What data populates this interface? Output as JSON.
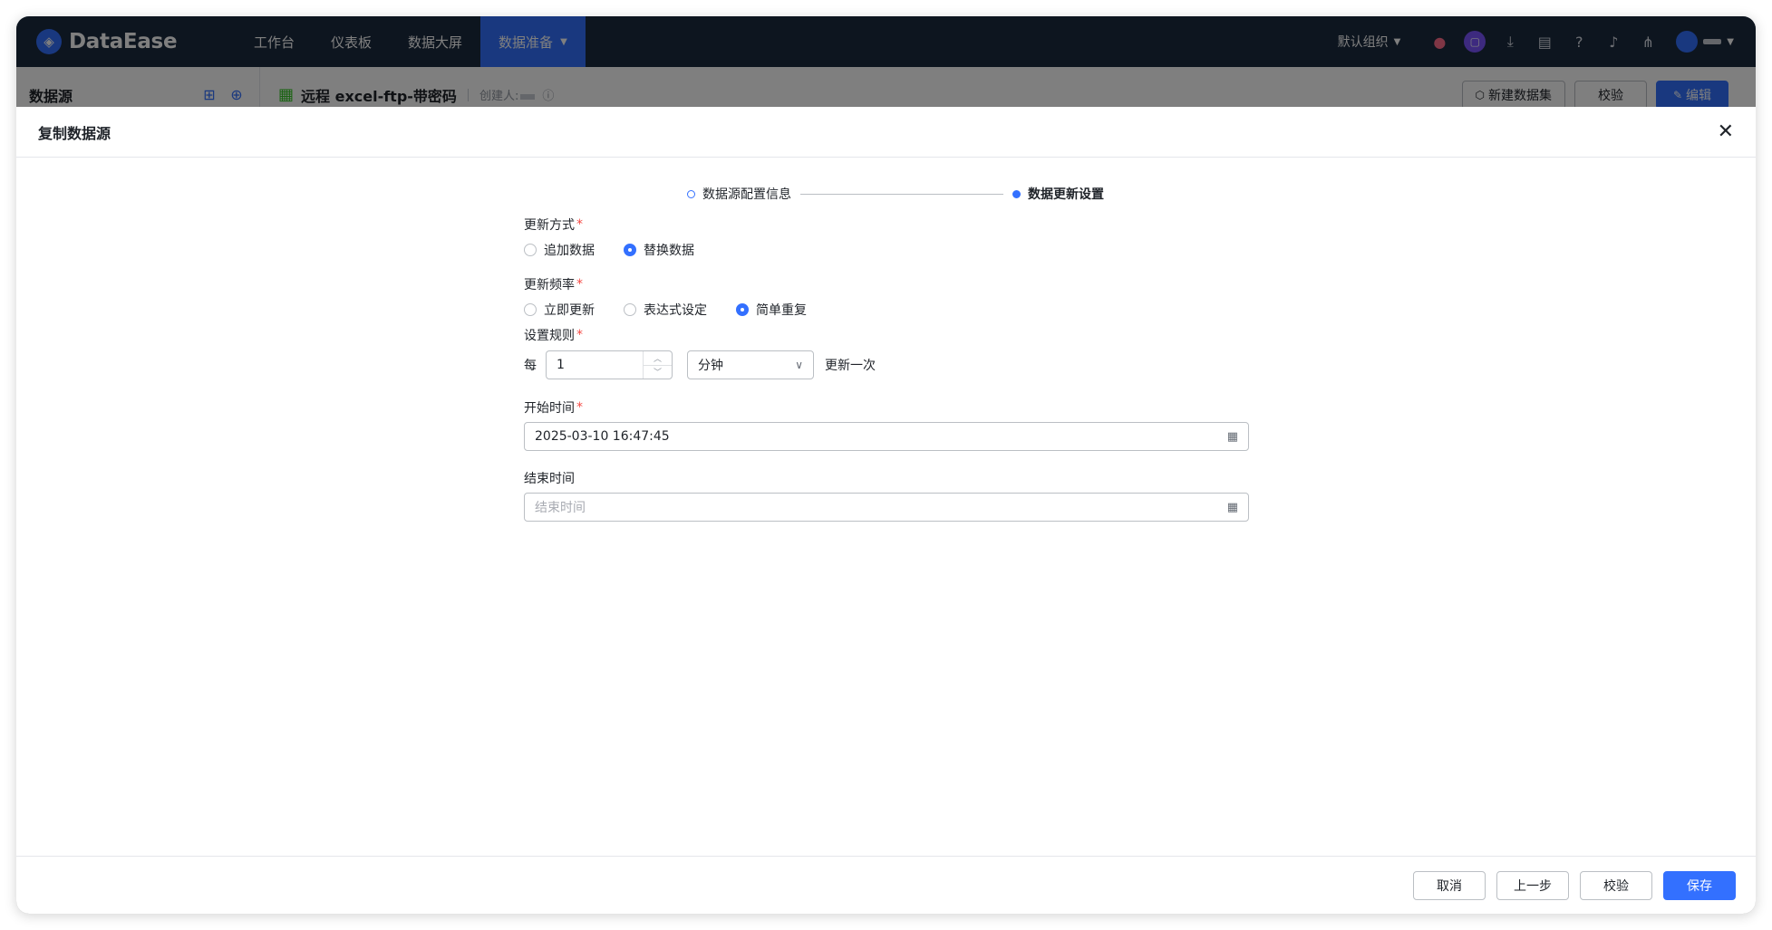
{
  "app": {
    "logo_text": "DataEase",
    "nav": [
      {
        "label": "工作台",
        "active": false
      },
      {
        "label": "仪表板",
        "active": false
      },
      {
        "label": "数据大屏",
        "active": false
      },
      {
        "label": "数据准备",
        "active": true
      }
    ],
    "org_label": "默认组织",
    "accent_color": "#3370ff"
  },
  "subheader": {
    "section_title": "数据源",
    "datasource_name": "远程 excel-ftp-带密码",
    "creator_label": "创建人:",
    "new_dataset_label": "新建数据集",
    "validate_label": "校验",
    "edit_label": "编辑"
  },
  "drawer": {
    "title": "复制数据源",
    "steps": [
      {
        "label": "数据源配置信息",
        "active": false
      },
      {
        "label": "数据更新设置",
        "active": true
      }
    ],
    "update_mode": {
      "label": "更新方式",
      "options": [
        {
          "label": "追加数据",
          "checked": false
        },
        {
          "label": "替换数据",
          "checked": true
        }
      ]
    },
    "update_frequency": {
      "label": "更新频率",
      "options": [
        {
          "label": "立即更新",
          "checked": false
        },
        {
          "label": "表达式设定",
          "checked": false
        },
        {
          "label": "简单重复",
          "checked": true
        }
      ]
    },
    "rule": {
      "label": "设置规则",
      "prefix": "每",
      "value": "1",
      "unit": "分钟",
      "suffix": "更新一次"
    },
    "start_time": {
      "label": "开始时间",
      "value": "2025-03-10 16:47:45"
    },
    "end_time": {
      "label": "结束时间",
      "placeholder": "结束时间"
    },
    "footer": {
      "cancel": "取消",
      "prev": "上一步",
      "validate": "校验",
      "save": "保存"
    }
  }
}
